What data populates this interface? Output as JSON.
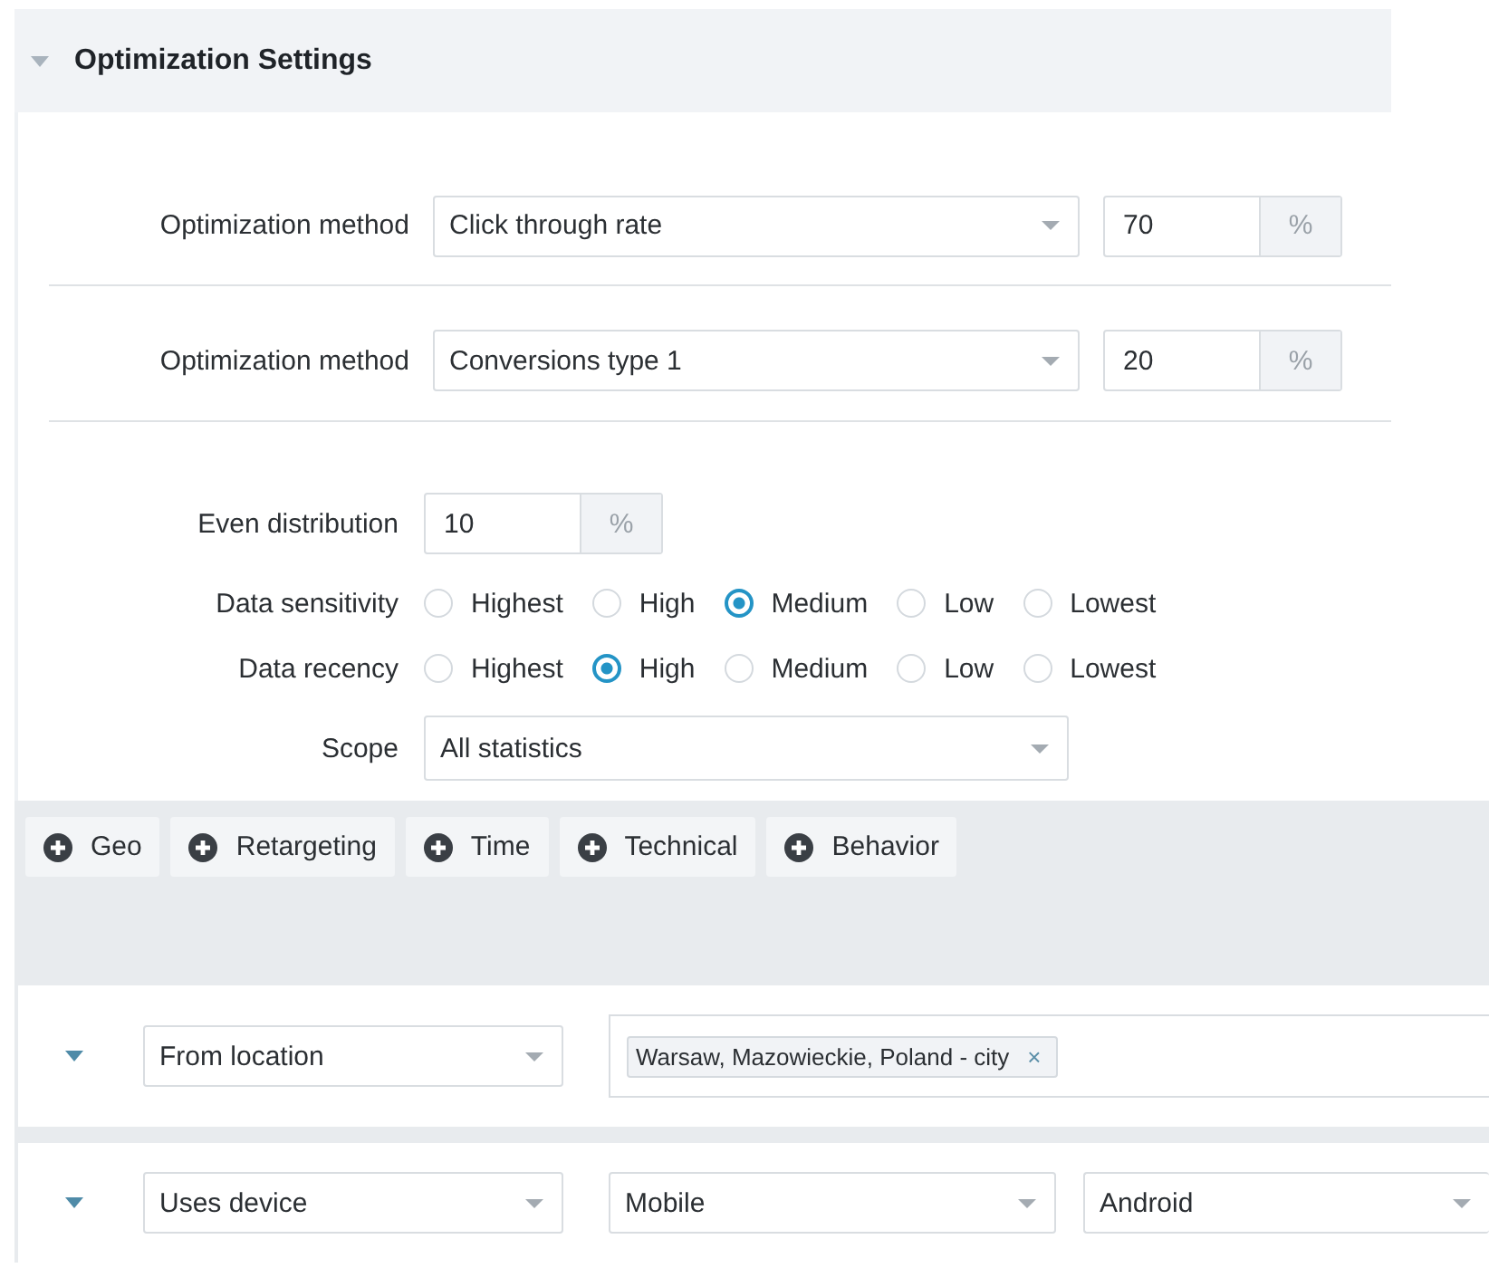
{
  "section": {
    "title": "Optimization Settings",
    "expanded": true
  },
  "methods": [
    {
      "label": "Optimization method",
      "value": "Click through rate",
      "percent": "70",
      "unit": "%"
    },
    {
      "label": "Optimization method",
      "value": "Conversions type 1",
      "percent": "20",
      "unit": "%"
    }
  ],
  "even_distribution": {
    "label": "Even distribution",
    "value": "10",
    "unit": "%"
  },
  "radio_groups": [
    {
      "label": "Data sensitivity",
      "options": [
        {
          "label": "Highest",
          "selected": false
        },
        {
          "label": "High",
          "selected": false
        },
        {
          "label": "Medium",
          "selected": true
        },
        {
          "label": "Low",
          "selected": false
        },
        {
          "label": "Lowest",
          "selected": false
        }
      ]
    },
    {
      "label": "Data recency",
      "options": [
        {
          "label": "Highest",
          "selected": false
        },
        {
          "label": "High",
          "selected": true
        },
        {
          "label": "Medium",
          "selected": false
        },
        {
          "label": "Low",
          "selected": false
        },
        {
          "label": "Lowest",
          "selected": false
        }
      ]
    }
  ],
  "scope": {
    "label": "Scope",
    "value": "All statistics"
  },
  "add_buttons": [
    "Geo",
    "Retargeting",
    "Time",
    "Technical",
    "Behavior"
  ],
  "rules": [
    {
      "expanded": true,
      "kind": "tags",
      "condition": "From location",
      "tags": [
        {
          "label": "Warsaw, Mazowieckie, Poland - city",
          "remove": "×"
        }
      ]
    },
    {
      "expanded": true,
      "kind": "selects",
      "condition": "Uses device",
      "values": [
        "Mobile",
        "Android"
      ]
    }
  ]
}
